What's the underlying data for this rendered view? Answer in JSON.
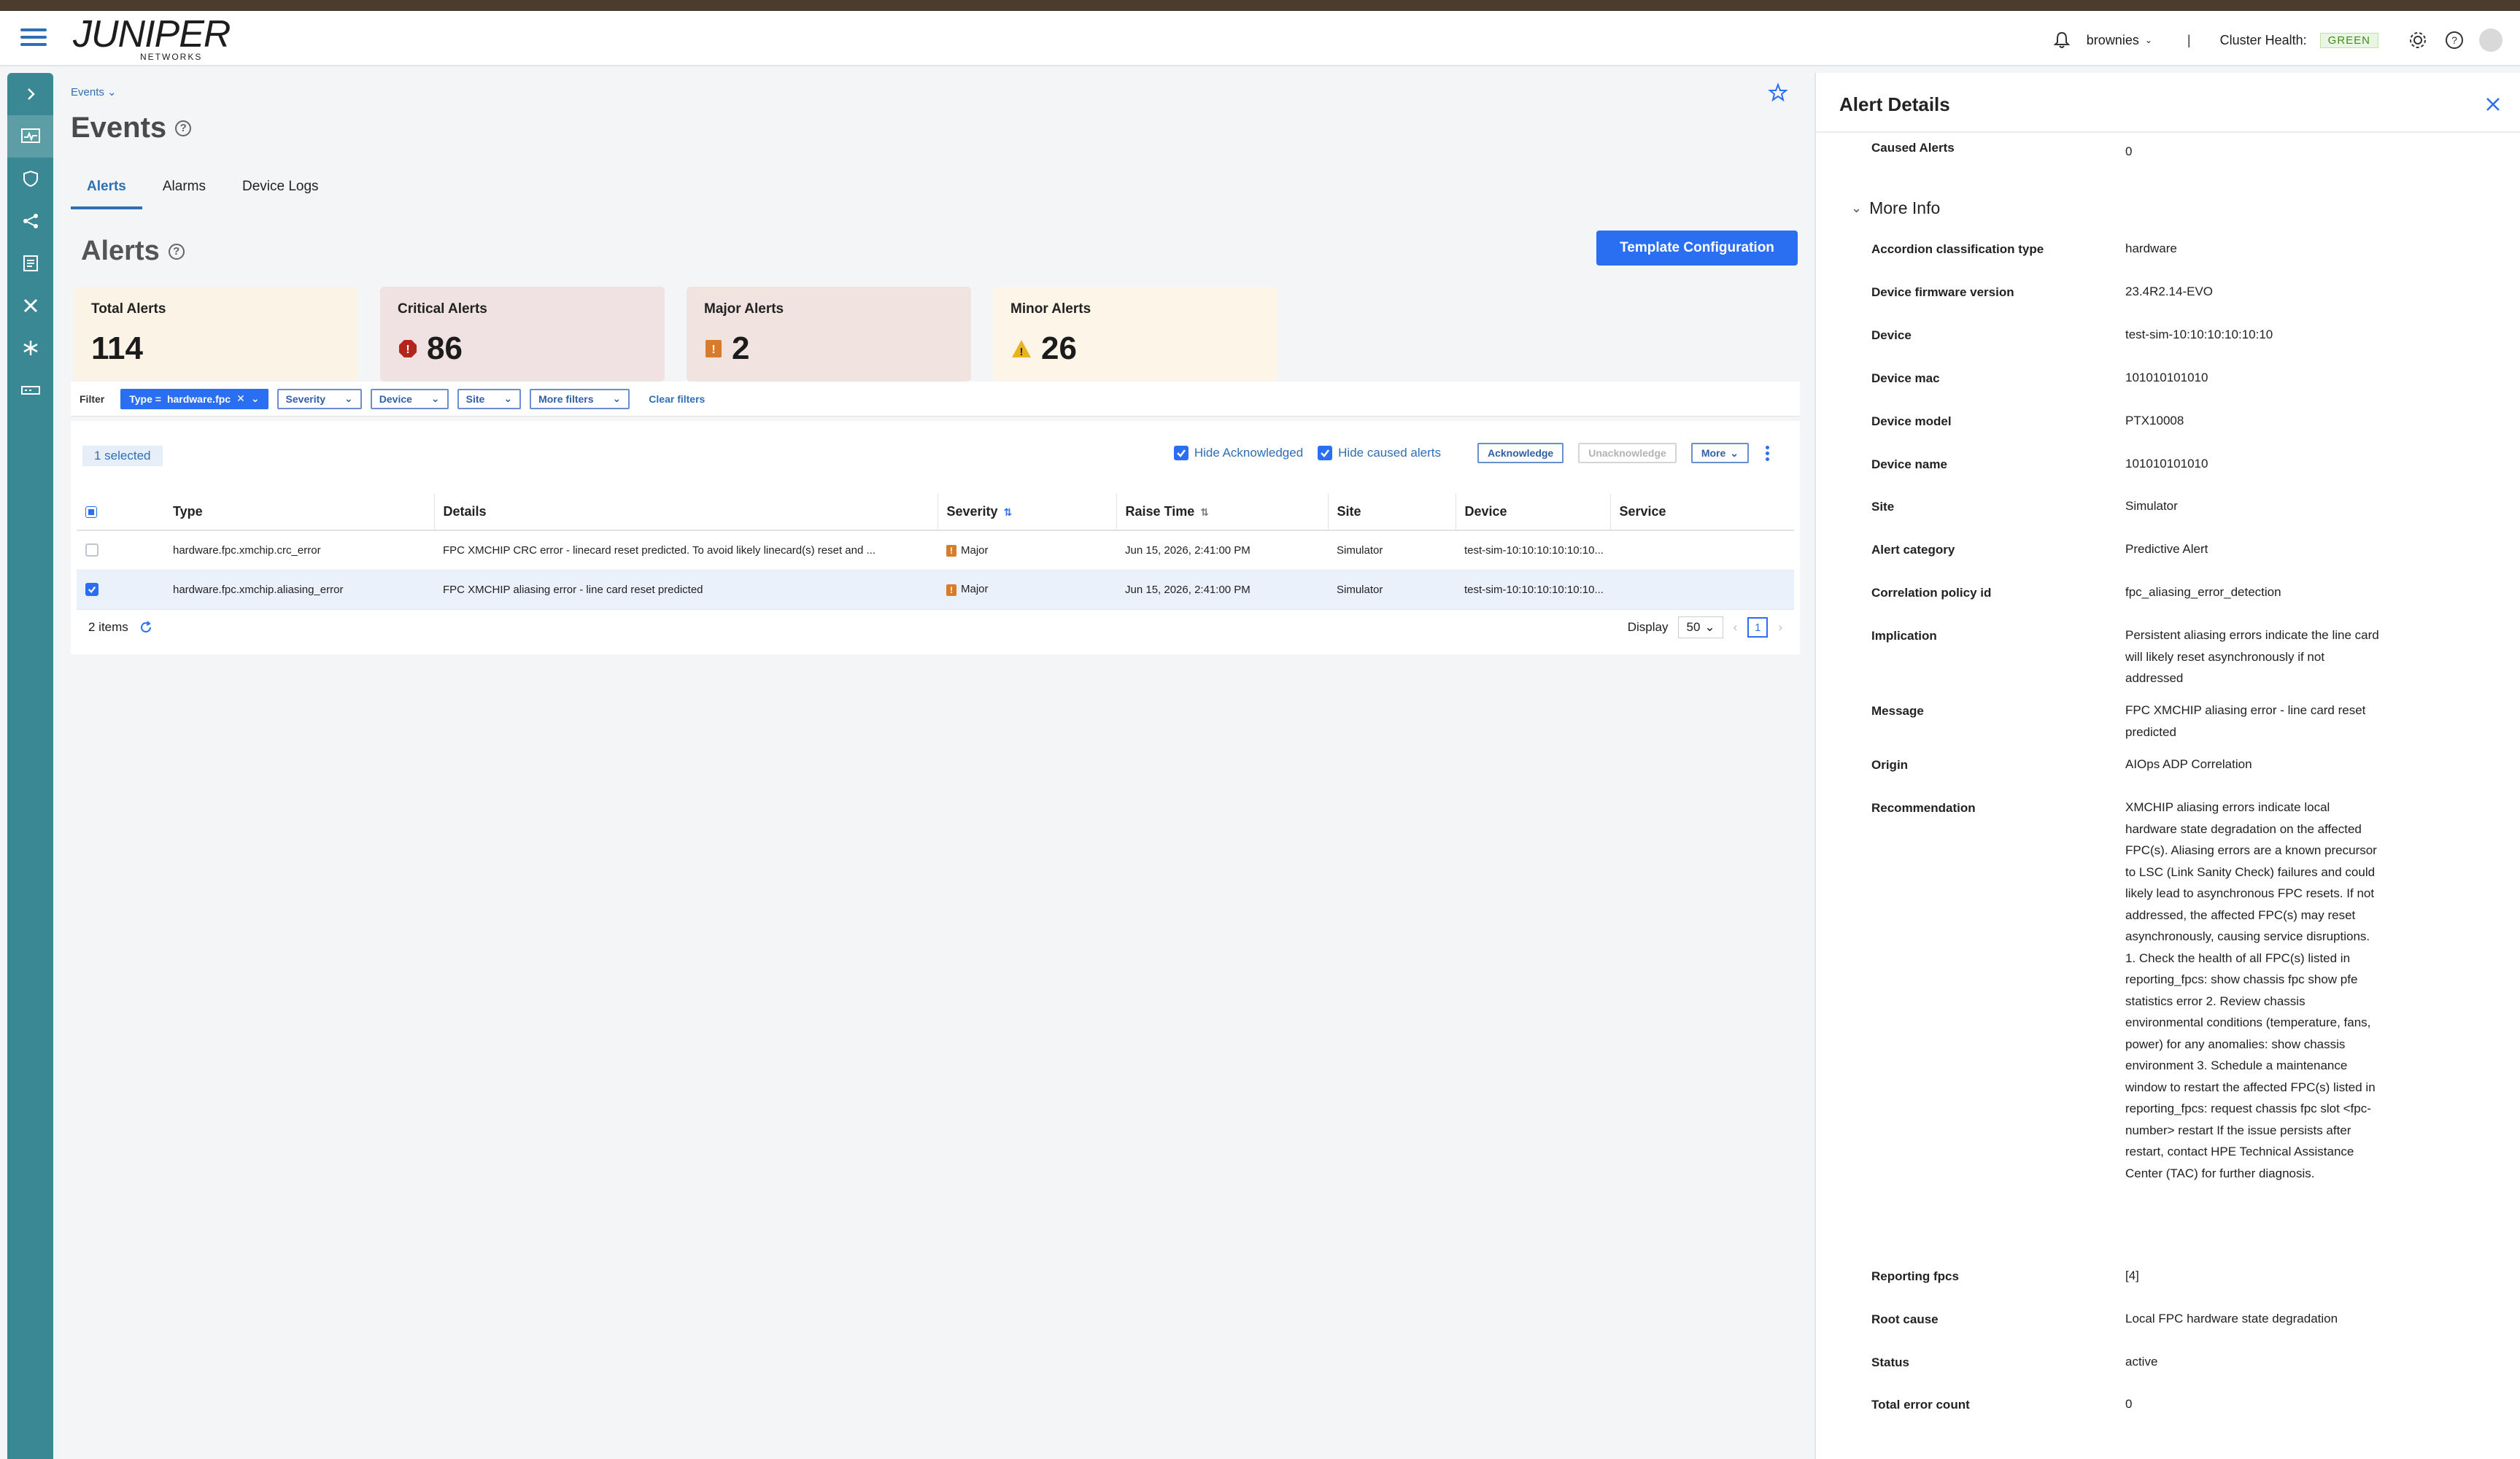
{
  "topbar": {
    "logo_text": "JUNIPER",
    "logo_sub": "NETWORKS",
    "user": "brownies",
    "separator": "|",
    "health_label": "Cluster Health:",
    "health_value": "GREEN",
    "colors": {
      "brand_strip": "#4b3c2d",
      "health": "#3e8e1f"
    }
  },
  "nav": {
    "icons": [
      "chevron-right-icon",
      "monitor-icon",
      "shield-icon",
      "topology-icon",
      "document-icon",
      "tools-icon",
      "snowflake-icon",
      "device-icon"
    ],
    "color": "#3a8893"
  },
  "main": {
    "breadcrumb": "Events",
    "title": "Events",
    "tabs": [
      {
        "label": "Alerts",
        "active": true
      },
      {
        "label": "Alarms",
        "active": false
      },
      {
        "label": "Device Logs",
        "active": false
      }
    ],
    "alerts_title": "Alerts",
    "template_button": "Template Configuration",
    "cards": {
      "total": {
        "label": "Total Alerts",
        "value": "114"
      },
      "critical": {
        "label": "Critical Alerts",
        "value": "86"
      },
      "major": {
        "label": "Major Alerts",
        "value": "2"
      },
      "minor": {
        "label": "Minor Alerts",
        "value": "26"
      }
    },
    "filter": {
      "label": "Filter",
      "active_chip_prefix": "Type = ",
      "active_chip_value": "hardware.fpc",
      "chips": [
        "Severity",
        "Device",
        "Site",
        "More filters"
      ],
      "clear": "Clear filters"
    },
    "toolbar": {
      "selected": "1 selected",
      "hide_ack": "Hide Acknowledged",
      "hide_caused": "Hide caused alerts",
      "acknowledge": "Acknowledge",
      "unacknowledge": "Unacknowledge",
      "more": "More"
    },
    "table": {
      "columns": [
        "Type",
        "Details",
        "Severity",
        "Raise Time",
        "Site",
        "Device",
        "Service"
      ],
      "rows": [
        {
          "type": "hardware.fpc.xmchip.crc_error",
          "details": "FPC XMCHIP CRC error - linecard reset predicted. To avoid likely linecard(s) reset and ...",
          "severity": "Major",
          "raise_time": "Jun 15, 2026, 2:41:00 PM",
          "site": "Simulator",
          "device": "test-sim-10:10:10:10:10:10...",
          "service": "",
          "selected": false
        },
        {
          "type": "hardware.fpc.xmchip.aliasing_error",
          "details": "FPC XMCHIP aliasing error - line card reset predicted",
          "severity": "Major",
          "raise_time": "Jun 15, 2026, 2:41:00 PM",
          "site": "Simulator",
          "device": "test-sim-10:10:10:10:10:10...",
          "service": "",
          "selected": true
        }
      ]
    },
    "footer": {
      "items": "2 items",
      "display_label": "Display",
      "page_size": "50",
      "page": "1"
    }
  },
  "detail": {
    "title": "Alert Details",
    "caused_alerts_label": "Caused Alerts",
    "caused_alerts_value": "0",
    "section": "More Info",
    "fields": [
      {
        "k": "Accordion classification type",
        "v": "hardware"
      },
      {
        "k": "Device firmware version",
        "v": "23.4R2.14-EVO"
      },
      {
        "k": "Device",
        "v": "test-sim-10:10:10:10:10:10"
      },
      {
        "k": "Device mac",
        "v": "101010101010"
      },
      {
        "k": "Device model",
        "v": "PTX10008"
      },
      {
        "k": "Device name",
        "v": "101010101010"
      },
      {
        "k": "Site",
        "v": "Simulator"
      },
      {
        "k": "Alert category",
        "v": "Predictive Alert"
      },
      {
        "k": "Correlation policy id",
        "v": "fpc_aliasing_error_detection"
      },
      {
        "k": "Implication",
        "v": "Persistent aliasing errors indicate the line card will likely reset asynchronously if not addressed"
      },
      {
        "k": "Message",
        "v": "FPC XMCHIP aliasing error - line card reset predicted"
      },
      {
        "k": "Origin",
        "v": "AIOps ADP Correlation"
      },
      {
        "k": "Recommendation",
        "v": "XMCHIP aliasing errors indicate local hardware state degradation on the affected FPC(s). Aliasing errors are a known precursor to LSC (Link Sanity Check) failures and could likely lead to asynchronous FPC resets. If not addressed, the affected FPC(s) may reset asynchronously, causing service disruptions. 1. Check the health of all FPC(s) listed in reporting_fpcs: show chassis fpc show pfe statistics error 2. Review chassis environmental conditions (temperature, fans, power) for any anomalies: show chassis environment 3. Schedule a maintenance window to restart the affected FPC(s) listed in reporting_fpcs: request chassis fpc slot <fpc-number> restart If the issue persists after restart, contact HPE Technical Assistance Center (TAC) for further diagnosis."
      },
      {
        "k": "Reporting fpcs",
        "v": "[4]"
      },
      {
        "k": "Root cause",
        "v": "Local FPC hardware state degradation"
      },
      {
        "k": "Status",
        "v": "active"
      },
      {
        "k": "Total error count",
        "v": "0"
      }
    ]
  }
}
